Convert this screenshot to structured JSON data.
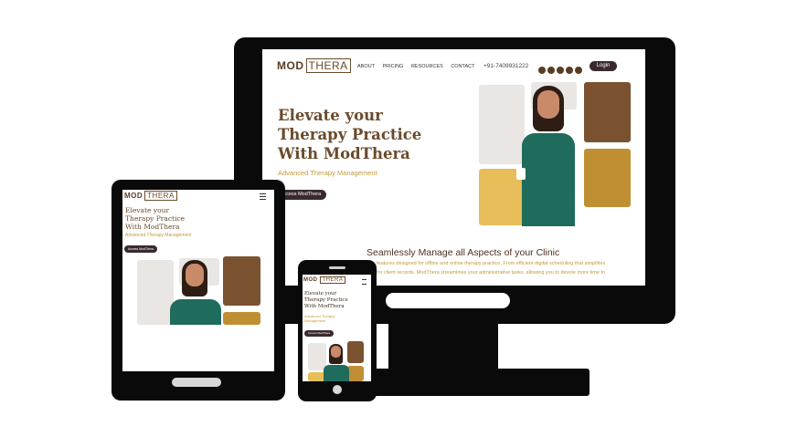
{
  "brand": {
    "mod": "MOD",
    "thera": "THERA"
  },
  "nav": [
    "ABOUT",
    "PRICING",
    "RESOURCES",
    "CONTACT"
  ],
  "phone": "+91-7409931222",
  "login_label": "Login",
  "hero": {
    "title_lines": [
      "Elevate your",
      "Therapy Practice",
      "With ModThera"
    ],
    "subtitle": "Advanced Therapy Management",
    "cta": "Access ModThera"
  },
  "mobile_subtitle_lines": [
    "Advanced Therapy",
    "Management"
  ],
  "section": {
    "heading": "Seamlessly Manage all Aspects of your Clinic",
    "line1": "features designed for offline and online therapy practice. From efficient digital scheduling that simplifies",
    "line2": "for client records. ModThera streamlines your administrative tasks, allowing you to devote more time to"
  },
  "colors": {
    "brown": "#6b4a2b",
    "dark_brown": "#7a5230",
    "gold": "#c08f34",
    "light_gold": "#e6bd58",
    "gray_tile": "#e9e6e3",
    "teal": "#1f6b5c"
  },
  "icons": [
    "instagram-icon",
    "youtube-icon",
    "linkedin-icon",
    "facebook-icon",
    "twitter-icon",
    "hamburger-menu-icon"
  ]
}
